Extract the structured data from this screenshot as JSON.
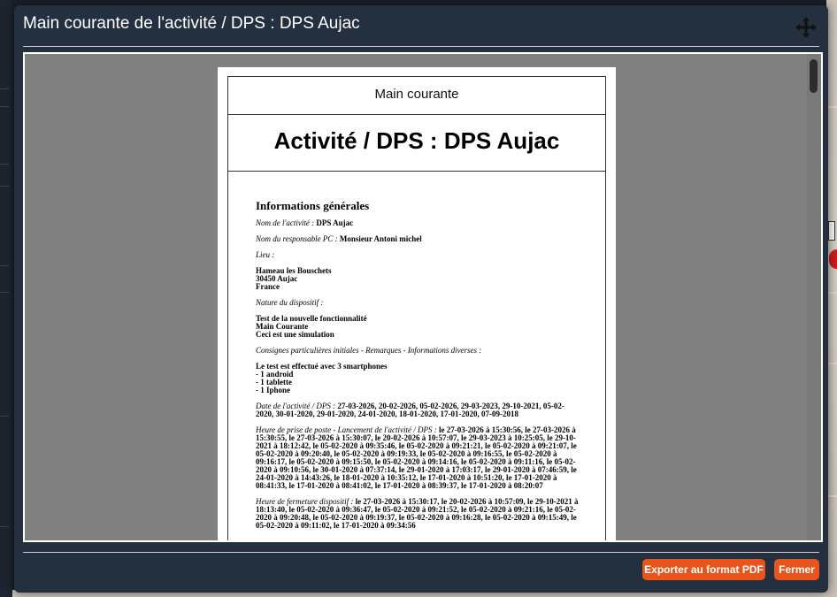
{
  "modal": {
    "title": "Main courante de l'activité / DPS : DPS Aujac"
  },
  "document": {
    "header_small": "Main courante",
    "header_large": "Activité / DPS : DPS Aujac",
    "section_title": "Informations générales",
    "activity_name_label": "Nom de l'activité :",
    "activity_name_value": "DPS Aujac",
    "responsible_label": "Nom du responsable PC :",
    "responsible_value": "Monsieur Antoni michel",
    "place_label": "Lieu :",
    "place_lines": [
      "Hameau les Bouschets",
      "30450 Aujac",
      "France"
    ],
    "nature_label": "Nature du dispositif :",
    "nature_lines": [
      "Test de la nouvelle fonctionnalité",
      "Main Courante",
      "Ceci est une simulation"
    ],
    "instructions_label": "Consignes particulières initiales - Remarques - Informations diverses :",
    "instructions_lines": [
      "Le test est effectué avec 3 smartphones",
      "- 1 android",
      "- 1 tablette",
      "- 1 Iphone"
    ],
    "date_label": "Date de l'activité / DPS :",
    "date_value": "27-03-2026, 20-02-2026, 05-02-2026, 29-03-2023, 29-10-2021, 05-02-2020, 30-01-2020, 29-01-2020, 24-01-2020, 18-01-2020, 17-01-2020, 07-09-2018",
    "start_label": "Heure de prise de poste - Lancement de l'activité / DPS :",
    "start_value": "le 27-03-2026 à 15:30:56, le 27-03-2026 à 15:30:55, le 27-03-2026 à 15:30:07, le 20-02-2026 à 10:57:07, le 29-03-2023 à 10:25:05, le 29-10-2021 à 18:12:42, le 05-02-2020 à 09:35:46, le 05-02-2020 à 09:21:21, le 05-02-2020 à 09:21:07, le 05-02-2020 à 09:20:40, le 05-02-2020 à 09:19:33, le 05-02-2020 à 09:16:55, le 05-02-2020 à 09:16:17, le 05-02-2020 à 09:15:50, le 05-02-2020 à 09:14:16, le 05-02-2020 à 09:11:16, le 05-02-2020 à 09:10:56, le 30-01-2020 à 07:37:14, le 29-01-2020 à 17:03:17, le 29-01-2020 à 07:46:59, le 24-01-2020 à 14:43:26, le 18-01-2020 à 10:35:12, le 17-01-2020 à 10:51:20, le 17-01-2020 à 08:41:33, le 17-01-2020 à 08:41:02, le 17-01-2020 à 08:39:37, le 17-01-2020 à 08:20:07",
    "close_label": "Heure de fermeture dispositif :",
    "close_value": "le 27-03-2026 à 15:30:17, le 20-02-2026 à 10:57:09, le 29-10-2021 à 18:13:40, le 05-02-2020 à 09:36:47, le 05-02-2020 à 09:21:52, le 05-02-2020 à 09:21:16, le 05-02-2020 à 09:20:48, le 05-02-2020 à 09:19:37, le 05-02-2020 à 09:16:28, le 05-02-2020 à 09:15:49, le 05-02-2020 à 09:11:02, le 17-01-2020 à 09:34:56"
  },
  "buttons": {
    "export_label": "Exporter au format PDF",
    "close_label": "Fermer"
  },
  "icons": {
    "move": "move-icon"
  },
  "colors": {
    "modal_bg": "#243040",
    "accent": "#e8551c",
    "viewer_bg": "#808080"
  }
}
